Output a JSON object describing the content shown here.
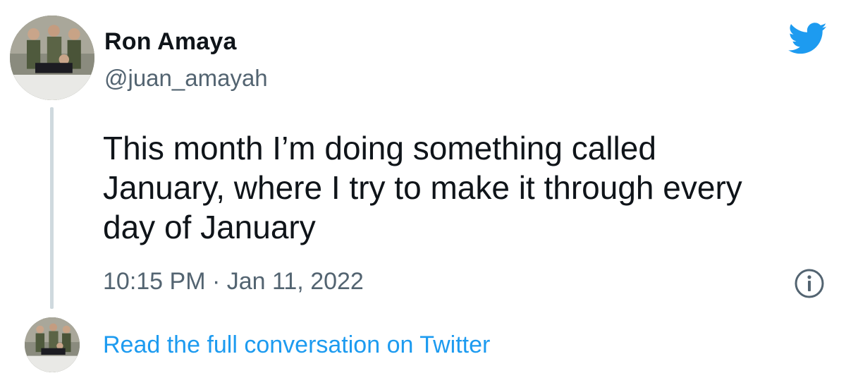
{
  "tweet": {
    "author": {
      "display_name": "Ron Amaya",
      "handle": "@juan_amayah",
      "avatar": "group-photo-avatar"
    },
    "text": "This month I’m doing something called\nJanuary, where I try to make it through every\nday of January",
    "timestamp": "10:15 PM · Jan 11, 2022",
    "icons": {
      "brand": "twitter-bird-icon",
      "info": "info-icon"
    },
    "colors": {
      "brand": "#1d9bf0",
      "text": "#0f1419",
      "secondary": "#536471",
      "thread_line": "#cfd9de"
    }
  },
  "footer": {
    "link_label": "Read the full conversation on Twitter"
  }
}
